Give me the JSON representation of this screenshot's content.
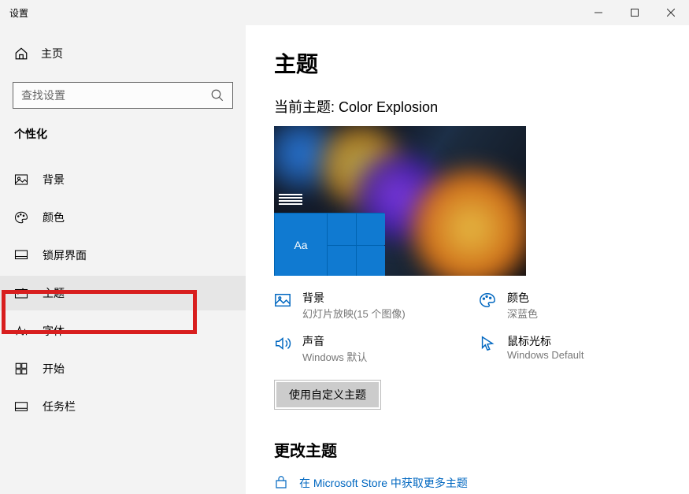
{
  "window": {
    "title": "设置"
  },
  "sidebar": {
    "home": "主页",
    "search_placeholder": "查找设置",
    "category": "个性化",
    "items": [
      {
        "label": "背景"
      },
      {
        "label": "颜色"
      },
      {
        "label": "锁屏界面"
      },
      {
        "label": "主题"
      },
      {
        "label": "字体"
      },
      {
        "label": "开始"
      },
      {
        "label": "任务栏"
      }
    ]
  },
  "main": {
    "heading": "主题",
    "current_prefix": "当前主题: ",
    "current_name": "Color Explosion",
    "preview_tile_text": "Aa",
    "options": {
      "bg_title": "背景",
      "bg_sub": "幻灯片放映(15 个图像)",
      "color_title": "颜色",
      "color_sub": "深蓝色",
      "sound_title": "声音",
      "sound_sub": "Windows 默认",
      "cursor_title": "鼠标光标",
      "cursor_sub": "Windows Default"
    },
    "apply_button": "使用自定义主题",
    "change_heading": "更改主题",
    "store_link": "在 Microsoft Store 中获取更多主题"
  }
}
